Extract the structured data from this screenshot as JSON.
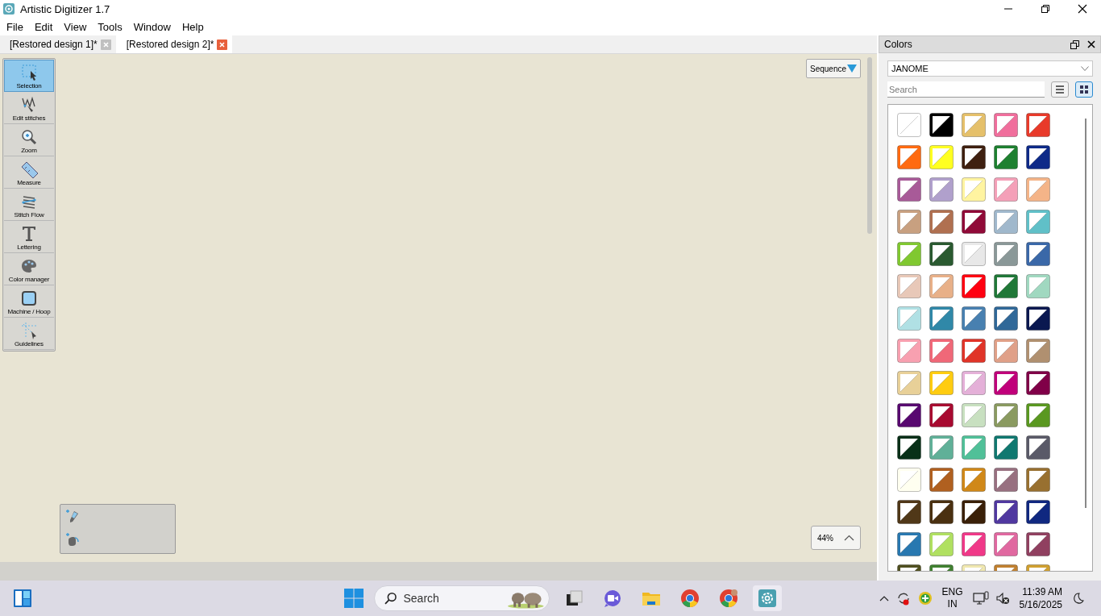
{
  "window": {
    "title": "Artistic Digitizer 1.7"
  },
  "menu": [
    "File",
    "Edit",
    "View",
    "Tools",
    "Window",
    "Help"
  ],
  "tabs": [
    {
      "label": "[Restored design 1]*",
      "selected": false
    },
    {
      "label": "[Restored design 2]*",
      "selected": true
    }
  ],
  "tools": [
    {
      "label": "Selection",
      "kind": "selection",
      "selected": true
    },
    {
      "label": "Edit stitches",
      "kind": "stitches",
      "selected": false
    },
    {
      "label": "Zoom",
      "kind": "zoom",
      "selected": false
    },
    {
      "label": "Measure",
      "kind": "measure",
      "selected": false
    },
    {
      "label": "Stitch Flow",
      "kind": "flow",
      "selected": false
    },
    {
      "label": "Lettering",
      "kind": "lettering",
      "selected": false
    },
    {
      "label": "Color manager",
      "kind": "palette",
      "selected": false
    },
    {
      "label": "Machine / Hoop",
      "kind": "hoop",
      "selected": false
    },
    {
      "label": "Guidelines",
      "kind": "guides",
      "selected": false
    }
  ],
  "canvas": {
    "sequence_button": "Sequence",
    "zoom_level": "44%"
  },
  "colors_panel": {
    "title": "Colors",
    "palette": "JANOME",
    "search": {
      "placeholder": "Search"
    },
    "view_modes": [
      {
        "kind": "list",
        "selected": false
      },
      {
        "kind": "grid",
        "selected": true
      }
    ],
    "swatches": [
      {
        "color": "#ffffff"
      },
      {
        "color": "#000000"
      },
      {
        "color": "#e5c06a"
      },
      {
        "color": "#f06e9c"
      },
      {
        "color": "#e83a2a"
      },
      {
        "color": "#ff6a10"
      },
      {
        "color": "#ffff20"
      },
      {
        "color": "#3f2010"
      },
      {
        "color": "#1e8030"
      },
      {
        "color": "#0e2a88"
      },
      {
        "color": "#a85a98"
      },
      {
        "color": "#b0a0cc"
      },
      {
        "color": "#fff4a0"
      },
      {
        "color": "#f4a0b8"
      },
      {
        "color": "#f4b488"
      },
      {
        "color": "#c8a080"
      },
      {
        "color": "#b07050"
      },
      {
        "color": "#900a38"
      },
      {
        "color": "#a0b8cc"
      },
      {
        "color": "#60c0c8"
      },
      {
        "color": "#80c830"
      },
      {
        "color": "#2a5a30"
      },
      {
        "color": "#e8e8e8"
      },
      {
        "color": "#8a9898"
      },
      {
        "color": "#3a68a8"
      },
      {
        "color": "#e8c8b8"
      },
      {
        "color": "#e8b088"
      },
      {
        "color": "#ff0010"
      },
      {
        "color": "#207838"
      },
      {
        "color": "#a0d8c0"
      },
      {
        "color": "#b0e0e4"
      },
      {
        "color": "#3088a8"
      },
      {
        "color": "#4880b0"
      },
      {
        "color": "#306898"
      },
      {
        "color": "#0a1850"
      },
      {
        "color": "#f8a0b0"
      },
      {
        "color": "#f06878"
      },
      {
        "color": "#e03428"
      },
      {
        "color": "#e0a088"
      },
      {
        "color": "#b09070"
      },
      {
        "color": "#e8d098"
      },
      {
        "color": "#ffcc10"
      },
      {
        "color": "#e4b0d8"
      },
      {
        "color": "#c0007a"
      },
      {
        "color": "#800048"
      },
      {
        "color": "#580870"
      },
      {
        "color": "#a80a30"
      },
      {
        "color": "#c8e0c0"
      },
      {
        "color": "#8a9a60"
      },
      {
        "color": "#5a9820"
      },
      {
        "color": "#083018"
      },
      {
        "color": "#60b098"
      },
      {
        "color": "#50c098"
      },
      {
        "color": "#107870"
      },
      {
        "color": "#5a5a68"
      },
      {
        "color": "#fffff0"
      },
      {
        "color": "#b06020"
      },
      {
        "color": "#d08818"
      },
      {
        "color": "#987080"
      },
      {
        "color": "#987030"
      },
      {
        "color": "#503818"
      },
      {
        "color": "#4a3010"
      },
      {
        "color": "#3a2008"
      },
      {
        "color": "#5038a0"
      },
      {
        "color": "#102880"
      },
      {
        "color": "#2878b0"
      },
      {
        "color": "#b0e060"
      },
      {
        "color": "#f03888"
      },
      {
        "color": "#e068a0"
      },
      {
        "color": "#904060"
      },
      {
        "color": "#505020"
      },
      {
        "color": "#408030"
      },
      {
        "color": "#f0e8b0"
      },
      {
        "color": "#c08030"
      },
      {
        "color": "#d0a030"
      }
    ]
  },
  "taskbar": {
    "search": {
      "placeholder": "Search"
    },
    "language": "ENG",
    "region": "IN",
    "time": "11:39 AM",
    "date": "5/16/2025"
  }
}
